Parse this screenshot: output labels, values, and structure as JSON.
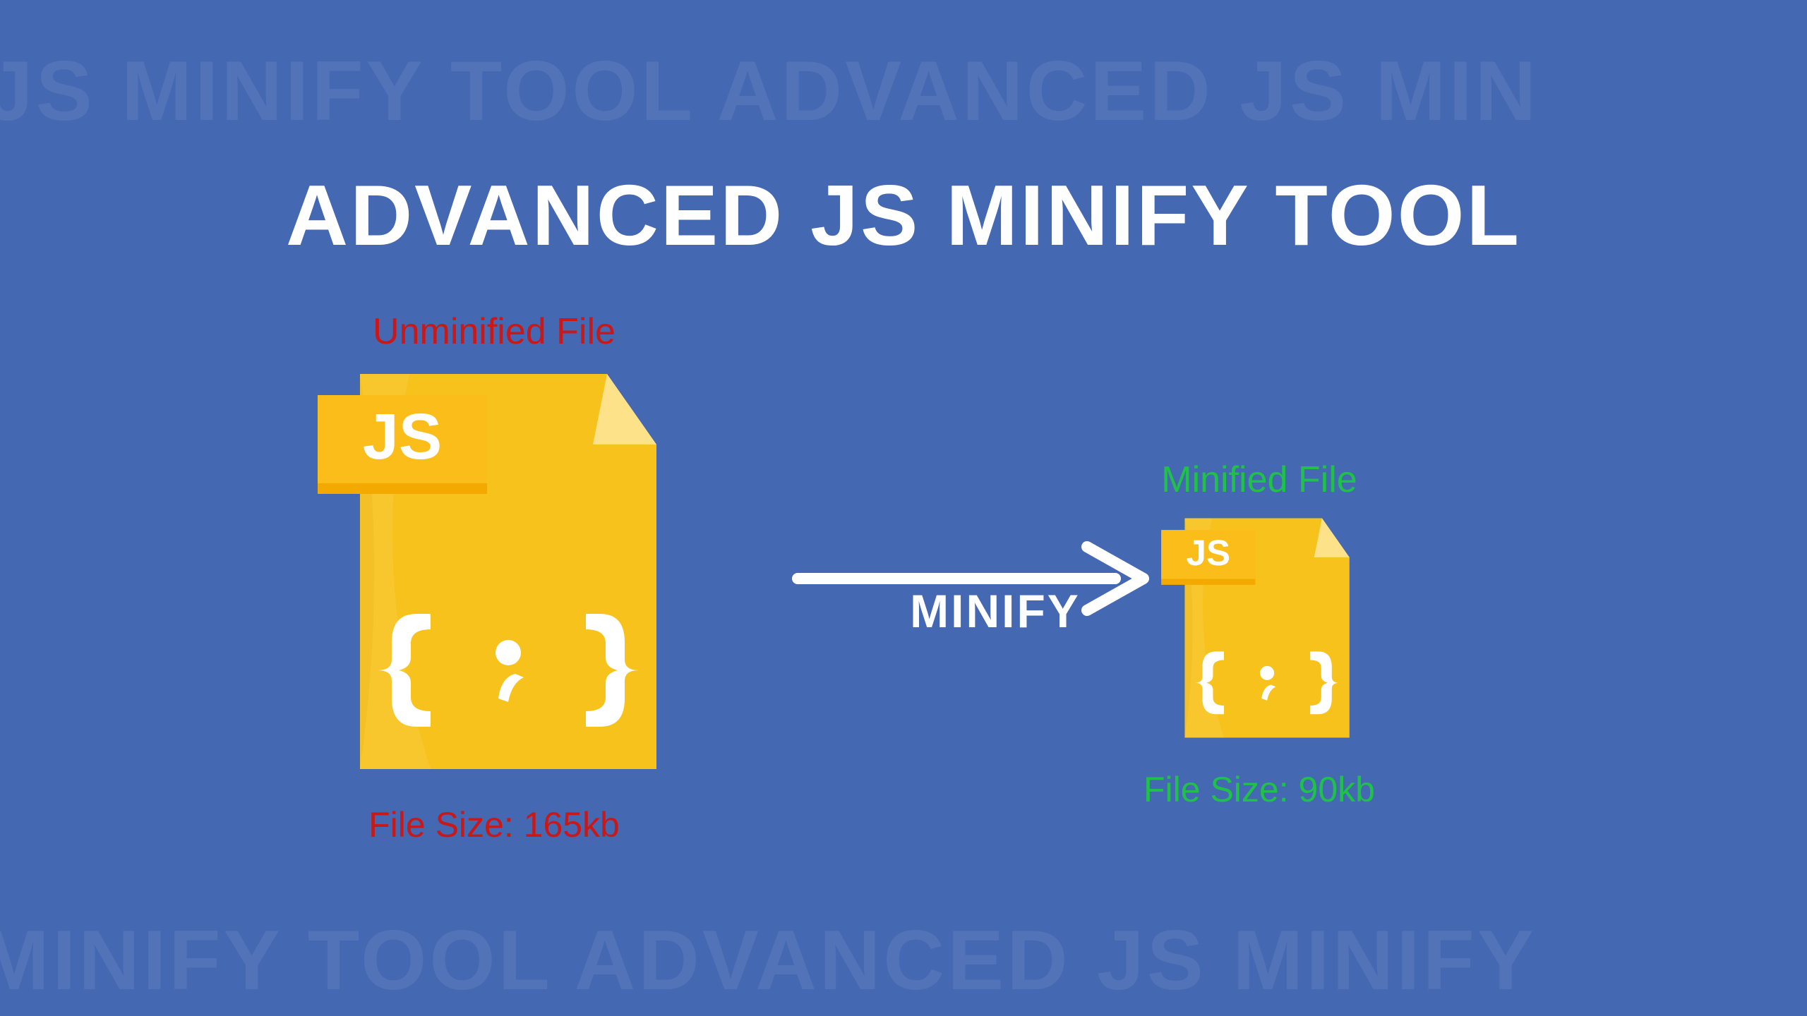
{
  "title": "ADVANCED JS MINIFY TOOL",
  "bg_text_top": "JS MINIFY TOOL   ADVANCED JS MIN",
  "bg_text_bottom": "MINIFY TOOL   ADVANCED JS MINIFY",
  "left": {
    "label_top": "Unminified File",
    "label_bottom": "File Size: 165kb",
    "js_badge": "JS"
  },
  "right": {
    "label_top": "Minified File",
    "label_bottom": "File Size: 90kb",
    "js_badge": "JS"
  },
  "arrow_label": "MINIFY",
  "icon_colors": {
    "file_fill": "#f8c21c",
    "file_dark": "#e8a600",
    "fold_light": "#fde28a",
    "tab_fill": "#f4a900",
    "tab_light": "#fbbd1a",
    "code_white": "#ffffff"
  }
}
